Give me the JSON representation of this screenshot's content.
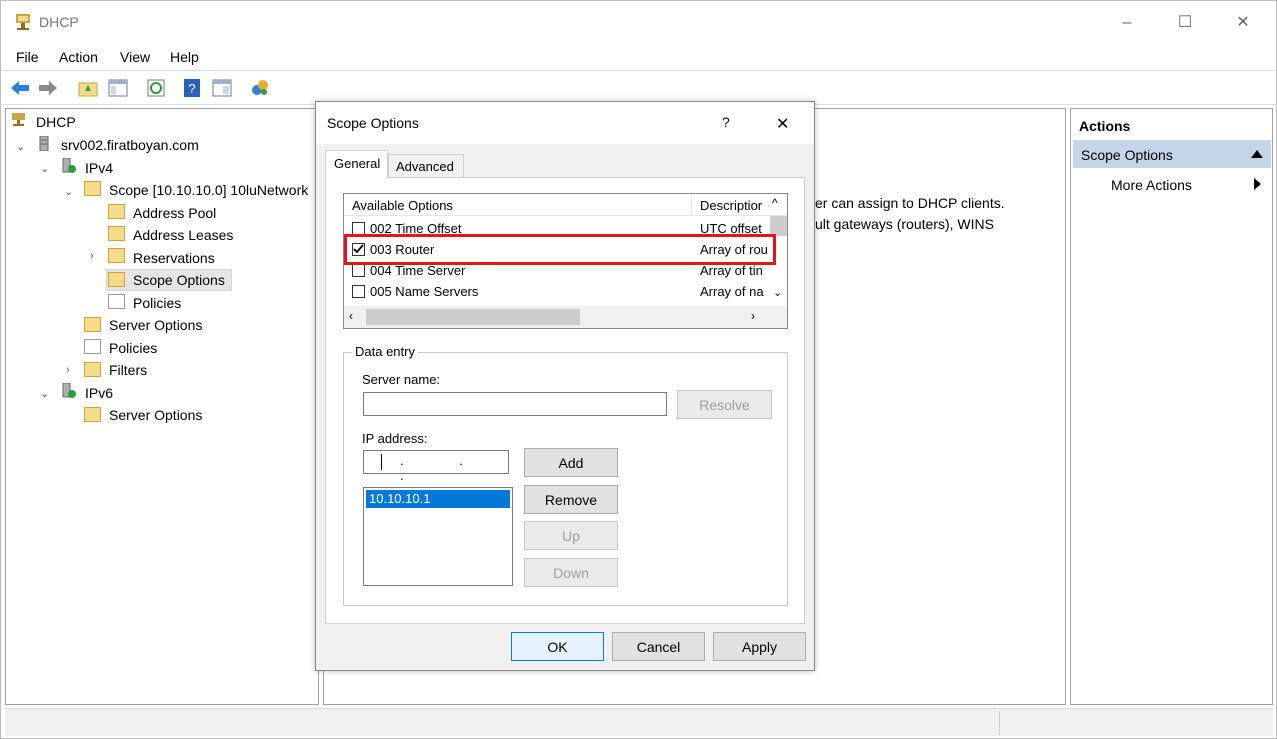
{
  "window": {
    "title": "DHCP",
    "minimize": "–",
    "maximize": "☐",
    "close": "✕"
  },
  "menu": [
    "File",
    "Action",
    "View",
    "Help"
  ],
  "tree": {
    "root": "DHCP",
    "server": "srv002.firatboyan.com",
    "ipv4": "IPv4",
    "scope": "Scope [10.10.10.0] 10luNetwork",
    "address_pool": "Address Pool",
    "address_leases": "Address Leases",
    "reservations": "Reservations",
    "scope_options": "Scope Options",
    "policies_scope": "Policies",
    "server_options": "Server Options",
    "policies": "Policies",
    "filters": "Filters",
    "ipv6": "IPv6",
    "server_options_v6": "Server Options"
  },
  "center": {
    "line1": "er can assign to DHCP clients.",
    "line2": "ult gateways (routers), WINS"
  },
  "actions": {
    "header": "Actions",
    "section": "Scope Options",
    "more": "More Actions"
  },
  "dialog": {
    "title": "Scope Options",
    "help": "?",
    "close": "✕",
    "tabs": [
      "General",
      "Advanced"
    ],
    "list_headers": [
      "Available Options",
      "Descriptior"
    ],
    "options": [
      {
        "name": "002 Time Offset",
        "desc": "UTC offset",
        "checked": false
      },
      {
        "name": "003 Router",
        "desc": "Array of rou",
        "checked": true
      },
      {
        "name": "004 Time Server",
        "desc": "Array of tin",
        "checked": false
      },
      {
        "name": "005 Name Servers",
        "desc": "Array of na",
        "checked": false
      }
    ],
    "data_entry": "Data entry",
    "server_name_label": "Server name:",
    "resolve": "Resolve",
    "ip_label": "IP address:",
    "ip_placeholder": ". . .",
    "add": "Add",
    "remove": "Remove",
    "up": "Up",
    "down": "Down",
    "ip_list": [
      "10.10.10.1"
    ],
    "ok": "OK",
    "cancel": "Cancel",
    "apply": "Apply"
  },
  "colors": {
    "highlight_box": "#e0161d",
    "selection": "#0078d7",
    "actions_section": "#c4d5e8"
  }
}
